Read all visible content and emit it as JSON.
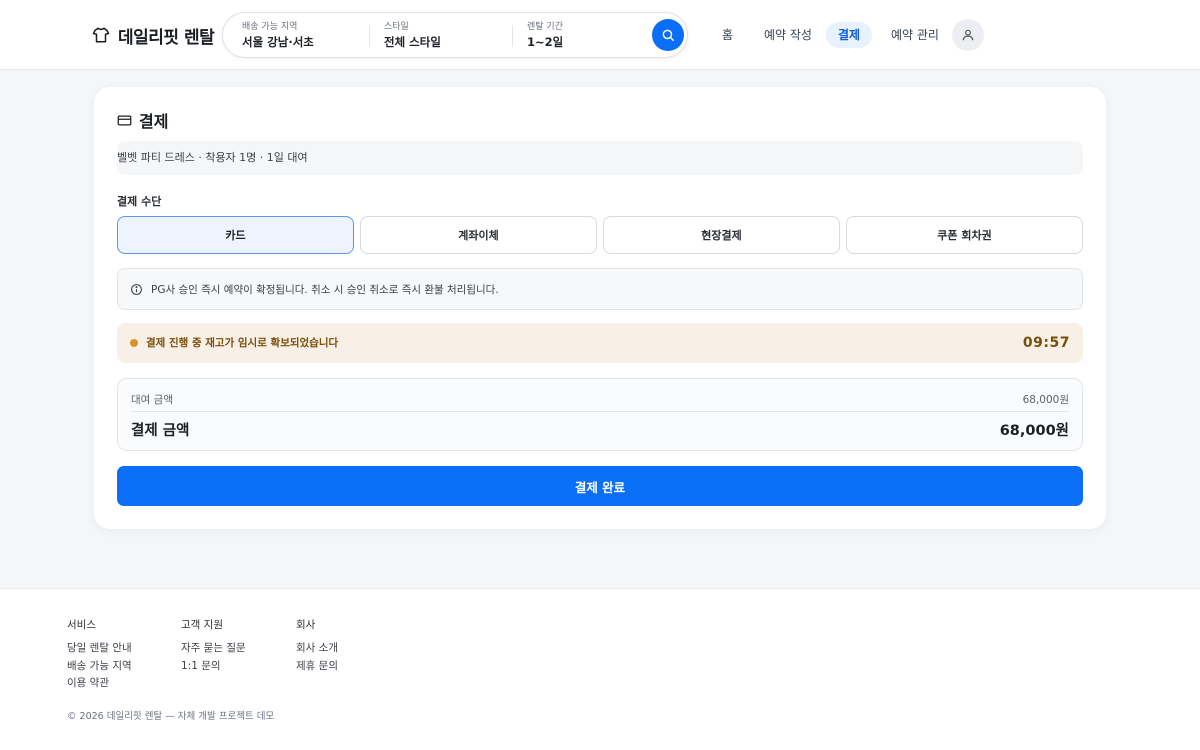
{
  "brand": {
    "name": "데일리핏 렌탈",
    "icon": "shirt-icon"
  },
  "search": {
    "segments": [
      {
        "label": "배송 가능 지역",
        "value": "서울 강남·서초"
      },
      {
        "label": "스타일",
        "value": "전체 스타일"
      },
      {
        "label": "렌탈 기간",
        "value": "1~2일"
      }
    ],
    "button_icon": "search-icon"
  },
  "nav": {
    "items": [
      {
        "label": "홈",
        "active": false
      },
      {
        "label": "예약 작성",
        "active": false
      },
      {
        "label": "결제",
        "active": true
      },
      {
        "label": "예약 관리",
        "active": false
      }
    ],
    "avatar_icon": "user-icon"
  },
  "payment": {
    "title": "결제",
    "title_icon": "credit-card-icon",
    "summary": "벨벳 파티 드레스 · 착용자 1명 · 1일 대여",
    "method_label": "결제 수단",
    "methods": [
      {
        "label": "카드",
        "selected": true
      },
      {
        "label": "계좌이체",
        "selected": false
      },
      {
        "label": "현장결제",
        "selected": false
      },
      {
        "label": "쿠폰 회차권",
        "selected": false
      }
    ],
    "info_text": "PG사 승인 즉시 예약이 확정됩니다. 취소 시 승인 취소로 즉시 환불 처리됩니다.",
    "info_icon": "info-icon",
    "hold_text": "결제 진행 중 재고가 임시로 확보되었습니다",
    "hold_timer": "09:57",
    "amounts": {
      "rental_label": "대여 금액",
      "rental_value": "68,000원",
      "total_label": "결제 금액",
      "total_value": "68,000원"
    },
    "submit_label": "결제 완료"
  },
  "footer": {
    "columns": [
      {
        "heading": "서비스",
        "links": [
          "당일 렌탈 안내",
          "배송 가능 지역",
          "이용 약관"
        ]
      },
      {
        "heading": "고객 지원",
        "links": [
          "자주 묻는 질문",
          "1:1 문의"
        ]
      },
      {
        "heading": "회사",
        "links": [
          "회사 소개",
          "제휴 문의"
        ]
      }
    ],
    "copyright": "© 2026 데일리핏 렌탈 — 자체 개발 프로젝트 데모"
  },
  "colors": {
    "accent": "#0b6ef6",
    "hold_bg": "#f8f0e6",
    "hold_text": "#7a4f0b"
  }
}
